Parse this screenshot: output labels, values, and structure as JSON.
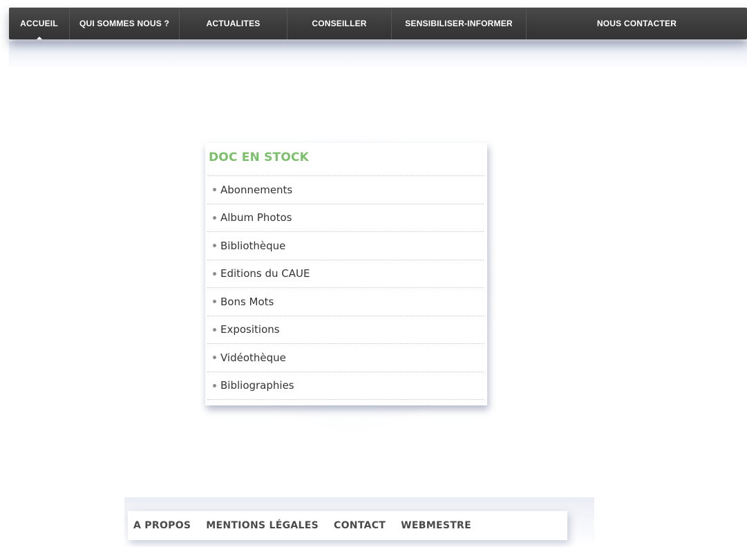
{
  "nav": {
    "items": [
      {
        "label": "ACCUEIL",
        "active": true
      },
      {
        "label": "QUI SOMMES NOUS ?",
        "active": false
      },
      {
        "label": "ACTUALITES",
        "active": false
      },
      {
        "label": "CONSEILLER",
        "active": false
      },
      {
        "label": "SENSIBILISER-INFORMER",
        "active": false
      },
      {
        "label": "NOUS CONTACTER",
        "active": false
      }
    ]
  },
  "doc_stock": {
    "title": "DOC EN STOCK",
    "items": [
      "Abonnements",
      "Album Photos",
      "Bibliothèque",
      "Editions du CAUE",
      "Bons Mots",
      "Expositions",
      "Vidéothèque",
      "Bibliographies"
    ]
  },
  "footer": {
    "links": [
      "A PROPOS",
      "MENTIONS LÉGALES",
      "CONTACT",
      "WEBMESTRE"
    ]
  },
  "colors": {
    "nav_background": "#3a3a3a",
    "nav_text": "#ffffff",
    "title_green": "#7cbf6a",
    "body_text": "#333333"
  },
  "icons": {
    "list_bullet": "bullet-icon",
    "active_marker": "caret-up-icon"
  }
}
